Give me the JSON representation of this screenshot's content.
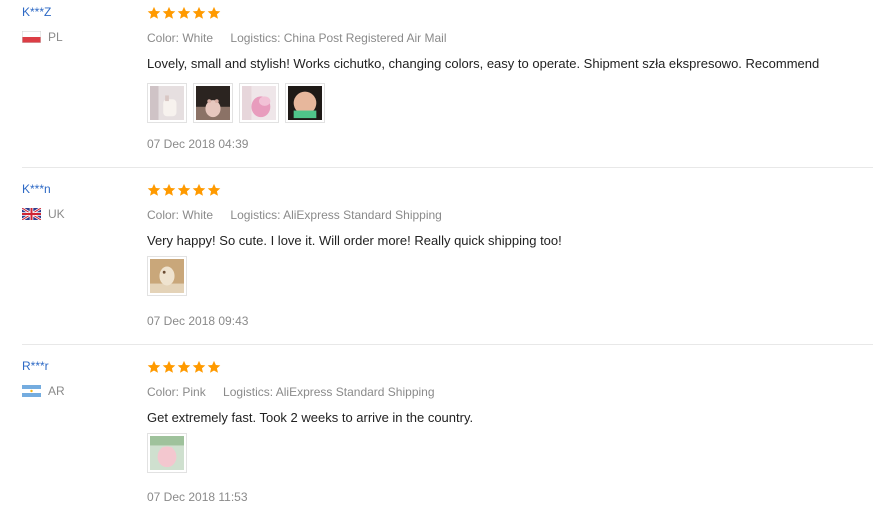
{
  "colors": {
    "username": "#2d69c5",
    "star": "#ff9a00",
    "meta_text": "#8a8a8a",
    "review_text": "#222222",
    "divider": "#e8e8e8"
  },
  "icons": {
    "star": "star-icon",
    "flag_pl": "flag-pl-icon",
    "flag_uk": "flag-uk-icon",
    "flag_ar": "flag-ar-icon"
  },
  "reviews": [
    {
      "user": "K***Z",
      "country": "PL",
      "rating": 5,
      "color_label": "Color:",
      "color_value": "White",
      "logistics_label": "Logistics:",
      "logistics_value": "China Post Registered Air Mail",
      "text": "Lovely, small and stylish! Works cichutko, changing colors, easy to operate. Shipment szła ekspresowo. Recommend",
      "photo_count": 4,
      "date": "07 Dec 2018 04:39"
    },
    {
      "user": "K***n",
      "country": "UK",
      "rating": 5,
      "color_label": "Color:",
      "color_value": "White",
      "logistics_label": "Logistics:",
      "logistics_value": "AliExpress Standard Shipping",
      "text": "Very happy! So cute. I love it. Will order more! Really quick shipping too!",
      "photo_count": 1,
      "date": "07 Dec 2018 09:43"
    },
    {
      "user": "R***r",
      "country": "AR",
      "rating": 5,
      "color_label": "Color:",
      "color_value": "Pink",
      "logistics_label": "Logistics:",
      "logistics_value": "AliExpress Standard Shipping",
      "text": "Get extremely fast. Took 2 weeks to arrive in the country.",
      "photo_count": 1,
      "date": "07 Dec 2018 11:53"
    }
  ]
}
